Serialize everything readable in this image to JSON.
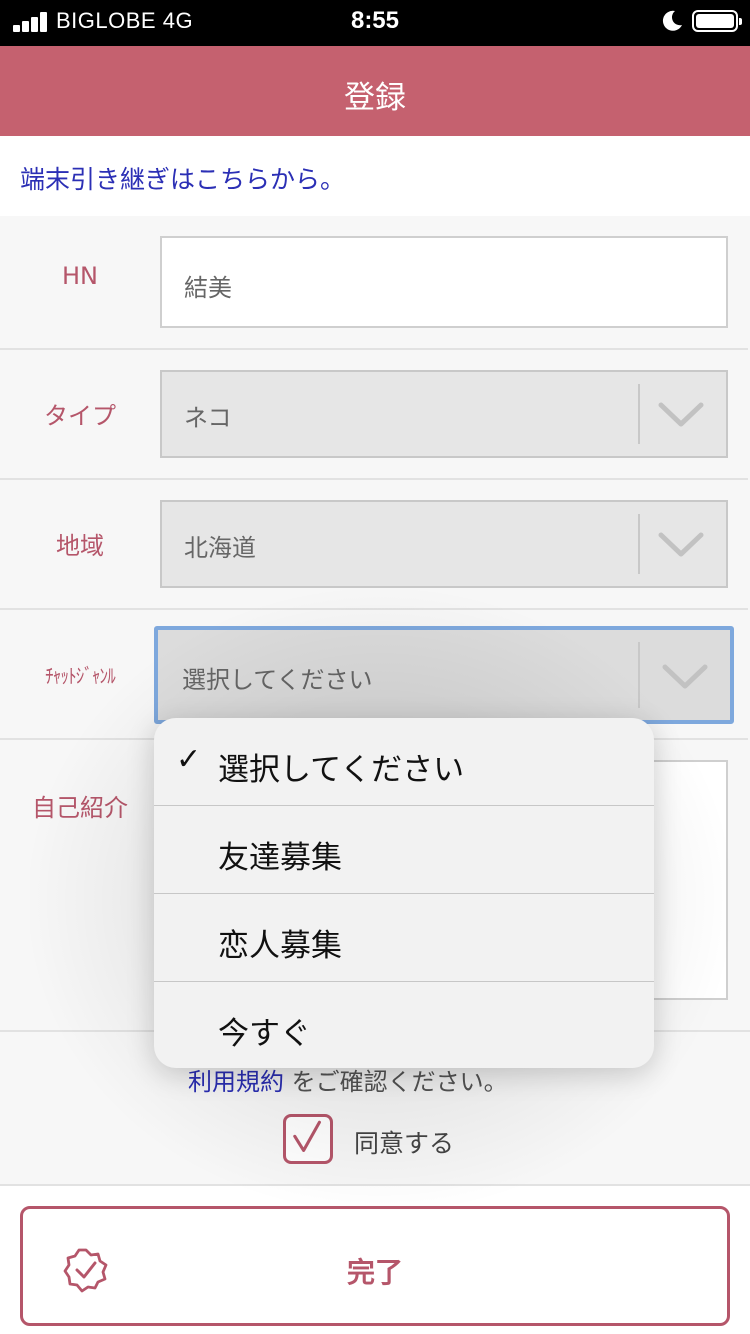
{
  "status_bar": {
    "carrier": "BIGLOBE  4G",
    "time": "8:55"
  },
  "nav": {
    "title": "登録"
  },
  "transfer_link": "端末引き継ぎはこちらから。",
  "form": {
    "hn": {
      "label": "HN",
      "value": "結美"
    },
    "type": {
      "label": "タイプ",
      "value": "ネコ"
    },
    "region": {
      "label": "地域",
      "value": "北海道"
    },
    "chat_genre": {
      "label": "ﾁｬｯﾄｼﾞｬﾝﾙ",
      "value": "選択してください"
    },
    "intro": {
      "label": "自己紹介",
      "value": ""
    }
  },
  "terms": {
    "link": "利用規約",
    "suffix": "をご確認ください。",
    "agree_label": "同意する",
    "agree_checked": true
  },
  "complete_button": "完了",
  "picker": {
    "options": [
      {
        "label": "選択してください",
        "selected": true
      },
      {
        "label": "友達募集",
        "selected": false
      },
      {
        "label": "恋人募集",
        "selected": false
      },
      {
        "label": "今すぐ",
        "selected": false
      }
    ]
  },
  "colors": {
    "accent": "#c5616f",
    "label": "#b5566a",
    "link": "#2b2fb5",
    "focus": "#7ea8dd"
  }
}
